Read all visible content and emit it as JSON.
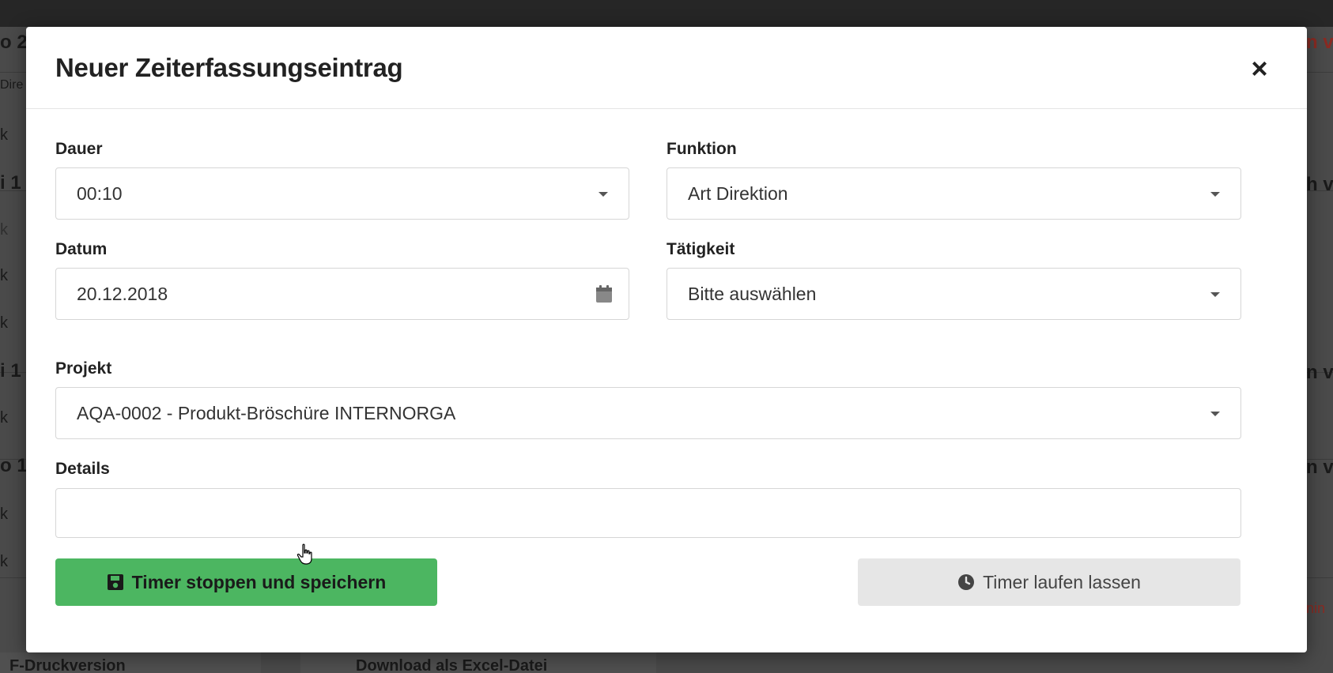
{
  "background": {
    "left_fragments": [
      "o 2",
      "Dire",
      "k",
      "i 1",
      "k",
      "k",
      "k",
      "i 1",
      "k",
      "o 1",
      "k",
      "k"
    ],
    "right_fragments": [
      "n v",
      "h v",
      "n v",
      "n v",
      "nin"
    ],
    "footer_left": "F-Druckversion",
    "footer_right": "Download als Excel-Datei"
  },
  "modal": {
    "title": "Neuer Zeiterfassungseintrag",
    "close_label": "×",
    "dauer": {
      "label": "Dauer",
      "value": "00:10"
    },
    "funktion": {
      "label": "Funktion",
      "value": "Art Direktion"
    },
    "datum": {
      "label": "Datum",
      "value": "20.12.2018"
    },
    "taetigkeit": {
      "label": "Tätigkeit",
      "value": "Bitte auswählen"
    },
    "projekt": {
      "label": "Projekt",
      "value": "AQA-0002 - Produkt-Bröschüre INTERNORGA"
    },
    "details": {
      "label": "Details",
      "value": ""
    },
    "save_button": "Timer stoppen und speichern",
    "timer_button": "Timer laufen lassen"
  },
  "colors": {
    "save_button": "#4cb661",
    "timer_button": "#e6e6e6",
    "overlay": "#2b2b2b"
  },
  "icons": {
    "save": "floppy-disk-icon",
    "timer": "clock-icon",
    "calendar": "calendar-icon",
    "dropdown": "caret-down-icon",
    "close": "close-icon"
  }
}
